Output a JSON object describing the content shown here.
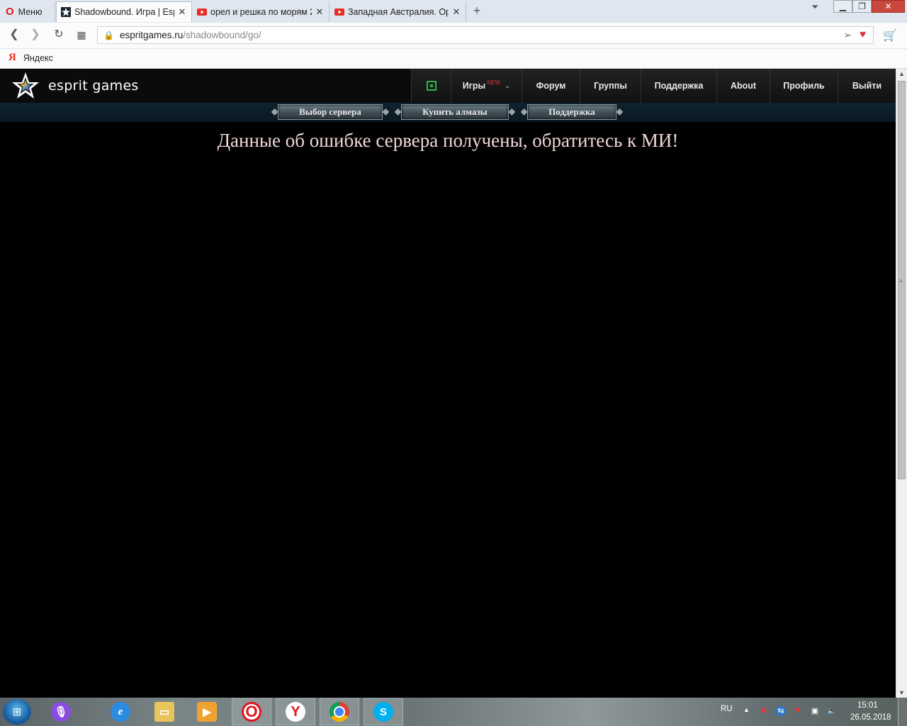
{
  "browser": {
    "menu_label": "Меню",
    "tabs": [
      {
        "title": "Shadowbound. Игра | Esprit",
        "icon": "star-icon",
        "active": true
      },
      {
        "title": "орел и решка по морям 2",
        "icon": "youtube-icon",
        "active": false
      },
      {
        "title": "Западная Австралия. Орёл",
        "icon": "youtube-icon",
        "active": false
      }
    ],
    "url_host": "espritgames.ru",
    "url_path": "/shadowbound/go/",
    "bookmarks": [
      {
        "label": "Яндекс",
        "icon": "yandex-icon"
      }
    ]
  },
  "site": {
    "logo_text": "esprit games",
    "menu": [
      {
        "label": "",
        "icon": "fullscreen-icon"
      },
      {
        "label": "Игры",
        "badge": "NEW",
        "icon": "chevron-down-icon"
      },
      {
        "label": "Форум"
      },
      {
        "label": "Группы"
      },
      {
        "label": "Поддержка"
      },
      {
        "label": "About"
      },
      {
        "label": "Профиль"
      },
      {
        "label": "Выйти"
      }
    ],
    "game_buttons": [
      "Выбор сервера",
      "Купить алмазы",
      "Поддержка"
    ],
    "error_message": "Данные об ошибке сервера получены, обратитесь к МИ!"
  },
  "taskbar": {
    "apps": [
      "start-icon",
      "microphone-icon",
      "ie-icon",
      "folder-icon",
      "media-player-icon",
      "opera-icon",
      "yandex-browser-icon",
      "chrome-icon",
      "skype-icon"
    ],
    "language": "RU",
    "time": "15:01",
    "date": "26.05.2018"
  },
  "colors": {
    "site_background": "#000000",
    "error_text": "#f2d7d7",
    "new_badge": "#e53131",
    "fullscreen_icon": "#2fb34a"
  }
}
